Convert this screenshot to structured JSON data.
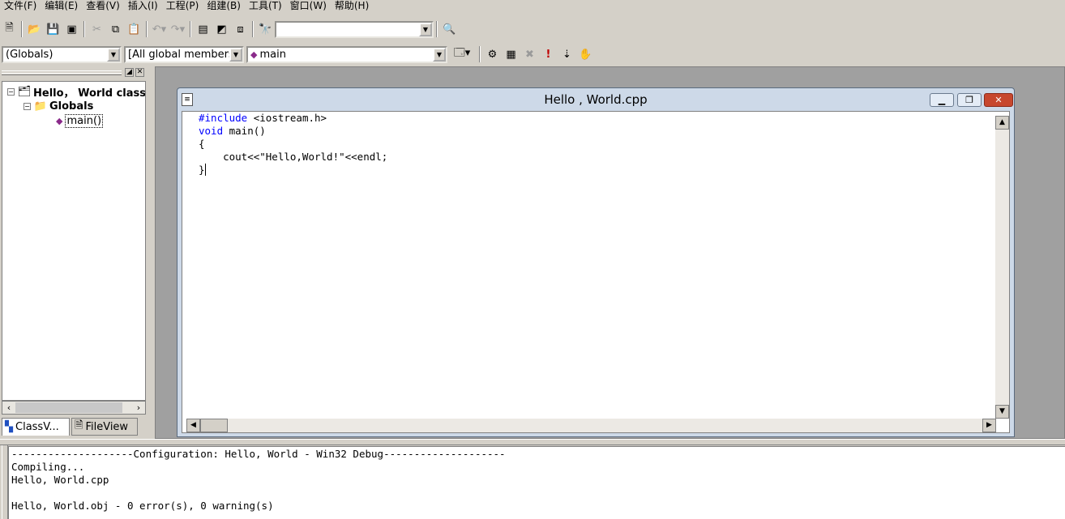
{
  "menu": [
    "文件(F)",
    "编辑(E)",
    "查看(V)",
    "插入(I)",
    "工程(P)",
    "组建(B)",
    "工具(T)",
    "窗口(W)",
    "帮助(H)"
  ],
  "toolbar": {
    "find_combo_value": "",
    "scope_combo": "(Globals)",
    "members_combo": "[All global members",
    "function_combo": "main"
  },
  "workspace": {
    "tree": {
      "root": "Hello， World class",
      "globals": "Globals",
      "main_fn": "main()"
    },
    "tabs": [
      "ClassV...",
      "FileView"
    ]
  },
  "document": {
    "title": "Hello , World.cpp",
    "code": [
      {
        "kw": "#include",
        "rest": " <iostream.h>"
      },
      {
        "kw": "void",
        "rest": " main()"
      },
      {
        "kw": "",
        "rest": "{"
      },
      {
        "kw": "",
        "rest": "    cout<<\"Hello,World!\"<<endl;"
      },
      {
        "kw": "",
        "rest": "}"
      }
    ]
  },
  "output": {
    "lines": [
      "--------------------Configuration: Hello, World - Win32 Debug--------------------",
      "Compiling...",
      "Hello, World.cpp",
      "",
      "Hello, World.obj - 0 error(s), 0 warning(s)"
    ]
  },
  "colors": {
    "keyword": "#0000ff",
    "close_button": "#c7472e",
    "title_bar": "#cdd9e8",
    "mdi_background": "#a0a0a0"
  }
}
